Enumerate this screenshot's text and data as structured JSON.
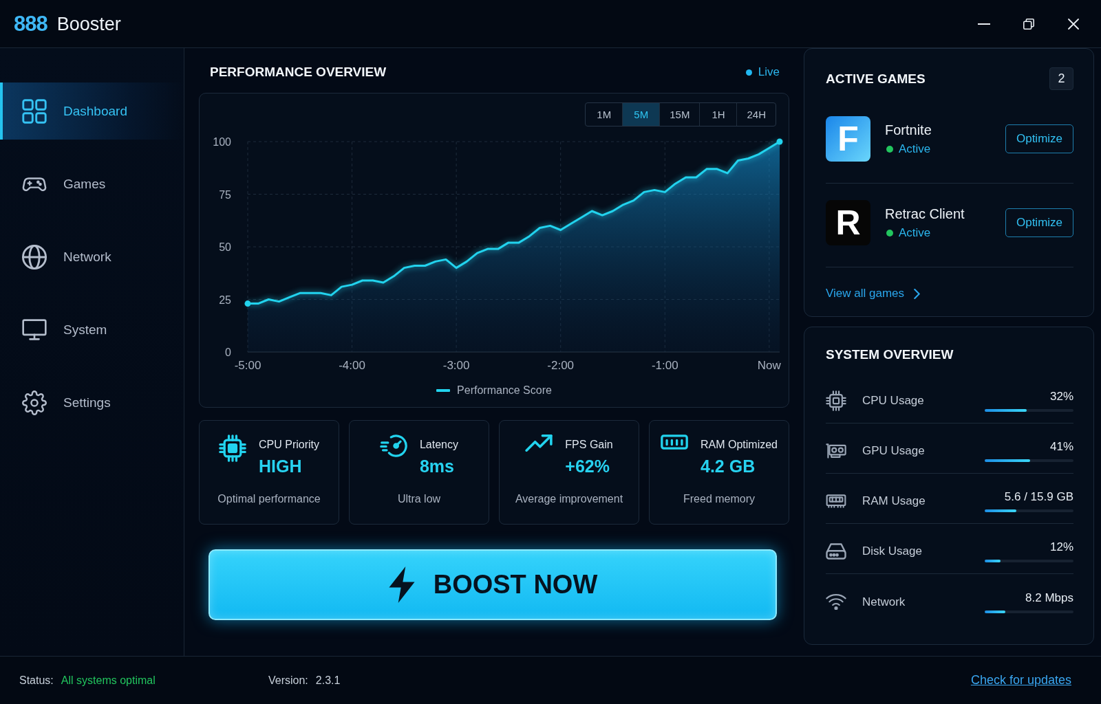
{
  "window": {
    "logo": "888",
    "title": "Booster"
  },
  "sidebar": {
    "items": [
      {
        "label": "Dashboard",
        "selected": true
      },
      {
        "label": "Games",
        "selected": false
      },
      {
        "label": "Network",
        "selected": false
      },
      {
        "label": "System",
        "selected": false
      },
      {
        "label": "Settings",
        "selected": false
      }
    ]
  },
  "performance": {
    "title": "PERFORMANCE OVERVIEW",
    "live_label": "Live",
    "ranges": [
      {
        "label": "1M",
        "selected": false
      },
      {
        "label": "5M",
        "selected": true
      },
      {
        "label": "15M",
        "selected": false
      },
      {
        "label": "1H",
        "selected": false
      },
      {
        "label": "24H",
        "selected": false
      }
    ],
    "chart_data": {
      "type": "area",
      "grid": true,
      "categories": [
        "-5:00",
        null,
        null,
        null,
        null,
        null,
        null,
        null,
        null,
        null,
        "-4:00",
        null,
        null,
        null,
        null,
        null,
        null,
        null,
        null,
        null,
        "-3:00",
        null,
        null,
        null,
        null,
        null,
        null,
        null,
        null,
        null,
        "-2:00",
        null,
        null,
        null,
        null,
        null,
        null,
        null,
        null,
        null,
        "-1:00",
        null,
        null,
        null,
        null,
        null,
        null,
        null,
        null,
        null,
        "Now",
        null
      ],
      "series": [
        {
          "name": "Performance Score",
          "color": "#22d3ee",
          "values": [
            23,
            23,
            25,
            24,
            26,
            28,
            28,
            28,
            27,
            31,
            32,
            34,
            34,
            33,
            36,
            40,
            41,
            41,
            43,
            44,
            40,
            43,
            47,
            49,
            49,
            52,
            52,
            55,
            59,
            60,
            58,
            61,
            64,
            67,
            65,
            67,
            70,
            72,
            76,
            77,
            76,
            80,
            83,
            83,
            87,
            87,
            85,
            91,
            92,
            94,
            97,
            100
          ]
        }
      ],
      "ylim": [
        0,
        100
      ],
      "yticks": [
        0,
        25,
        50,
        75,
        100
      ]
    }
  },
  "stats": [
    {
      "label": "CPU Priority",
      "value": "HIGH",
      "caption": "Optimal performance"
    },
    {
      "label": "Latency",
      "value": "8ms",
      "caption": "Ultra low"
    },
    {
      "label": "FPS Gain",
      "value": "+62%",
      "caption": "Average improvement"
    },
    {
      "label": "RAM Optimized",
      "value": "4.2 GB",
      "caption": "Freed memory"
    }
  ],
  "boost_button": {
    "label": "BOOST NOW"
  },
  "active_games": {
    "title": "ACTIVE GAMES",
    "count": "2",
    "games": [
      {
        "logo": "F",
        "name": "Fortnite",
        "status": "Active",
        "action": "Optimize"
      },
      {
        "logo": "R",
        "name": "Retrac Client",
        "status": "Active",
        "action": "Optimize"
      }
    ],
    "view_all": "View all games"
  },
  "system_overview": {
    "title": "SYSTEM OVERVIEW",
    "metrics": [
      {
        "label": "CPU Usage",
        "reading": "32%",
        "level": 0.47
      },
      {
        "label": "GPU Usage",
        "reading": "41%",
        "level": 0.51
      },
      {
        "label": "RAM Usage",
        "reading": "5.6 / 15.9 GB",
        "level": 0.36
      },
      {
        "label": "Disk Usage",
        "reading": "12%",
        "level": 0.18
      },
      {
        "label": "Network",
        "reading": "8.2 Mbps",
        "level": 0.23
      }
    ]
  },
  "status_bar": {
    "status_label": "Status:",
    "status": "All systems optimal",
    "version_label": "Version:",
    "version": "2.3.1",
    "update_link": "Check for updates"
  }
}
